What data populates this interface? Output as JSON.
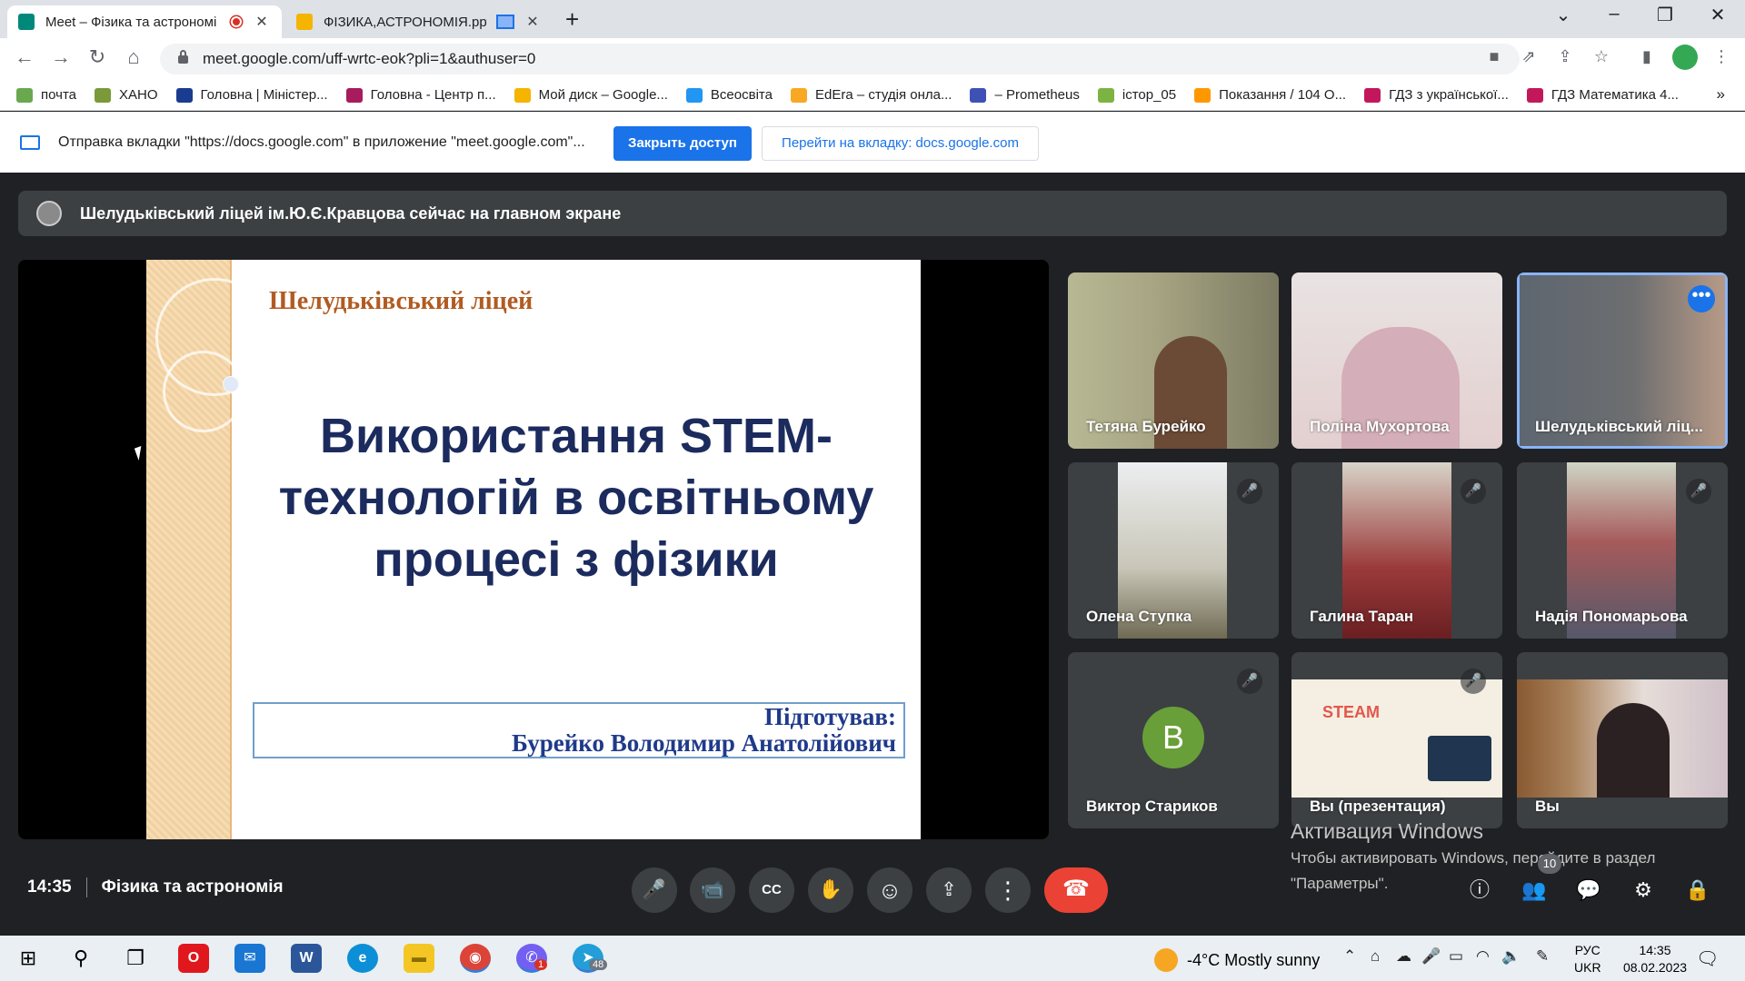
{
  "browser": {
    "tabs": [
      {
        "title": "Meet – Фізика та астрономі",
        "close": "✕",
        "favicon_color": "#00897b"
      },
      {
        "title": "ФІЗИКА,АСТРОНОМІЯ.pptx",
        "close": "✕",
        "favicon_color": "#f4b400"
      }
    ],
    "new_tab": "+",
    "url": "meet.google.com/uff-wrtc-eok?pli=1&authuser=0",
    "window_controls": {
      "tab_search": "⌄",
      "minimize": "–",
      "maximize": "❐",
      "close": "✕"
    },
    "nav": {
      "back": "←",
      "forward": "→",
      "reload": "↻",
      "home": "⌂"
    },
    "omnibox_icons": {
      "camera": "■",
      "open": "⇗",
      "share": "⇪",
      "star": "☆",
      "sidebar": "▮",
      "menu": "⋮"
    },
    "bookmarks": [
      {
        "label": "почта",
        "icon_color": "#6aa84f"
      },
      {
        "label": "ХАНО",
        "icon_color": "#7a9a3a"
      },
      {
        "label": "Головна | Міністер...",
        "icon_color": "#1a3c8f"
      },
      {
        "label": "Головна - Центр п...",
        "icon_color": "#a61c5c"
      },
      {
        "label": "Мой диск – Google...",
        "icon_color": "#f4b400"
      },
      {
        "label": "Всеосвіта",
        "icon_color": "#2196f3"
      },
      {
        "label": "EdEra – студія онла...",
        "icon_color": "#f9a825"
      },
      {
        "label": "– Prometheus",
        "icon_color": "#3f51b5"
      },
      {
        "label": "істор_05",
        "icon_color": "#7cb342"
      },
      {
        "label": "Показання / 104 О...",
        "icon_color": "#ff9800"
      },
      {
        "label": "ГДЗ з української...",
        "icon_color": "#c2185b"
      },
      {
        "label": "ГДЗ Математика 4...",
        "icon_color": "#c2185b"
      }
    ],
    "bookmarks_more": "»"
  },
  "infobar": {
    "message": "Отправка вкладки \"https://docs.google.com\" в приложение \"meet.google.com\"...",
    "stop_label": "Закрыть доступ",
    "goto_label": "Перейти на вкладку: docs.google.com"
  },
  "meet": {
    "banner": "Шелудьківський ліцей ім.Ю.Є.Кравцова сейчас на главном экране",
    "slide": {
      "school": "Шелудьківський ліцей",
      "title_lines": [
        "Використання STEM-",
        "технологій в освітньому",
        "процесі з фізики"
      ],
      "author_label": "Підготував:",
      "author_name": "Бурейко Володимир Анатолійович"
    },
    "participants": [
      {
        "name": "Тетяна Бурейко",
        "muted": false
      },
      {
        "name": "Поліна Мухортова",
        "muted": false
      },
      {
        "name": "Шелудьківський ліц...",
        "muted": false,
        "more": "•••"
      },
      {
        "name": "Олена Ступка",
        "muted": true
      },
      {
        "name": "Галина Таран",
        "muted": true
      },
      {
        "name": "Надія Пономарьова",
        "muted": true
      },
      {
        "name": "Виктор Стариков",
        "muted": true,
        "avatar_letter": "B"
      },
      {
        "name": "Вы (презентация)",
        "muted": true
      },
      {
        "name": "Вы",
        "muted": false
      }
    ],
    "presentation_thumb": "STEAM",
    "mic_off_icon": "🎤",
    "time": "14:35",
    "meeting_title": "Фізика та астрономія",
    "controls": {
      "mic": "🎤",
      "camera": "📹",
      "captions": "CC",
      "hand": "✋",
      "emoji": "☺",
      "present": "⇪",
      "more": "⋮",
      "hangup": "☎"
    },
    "right_controls": {
      "info": "ⓘ",
      "people": "👥",
      "chat": "💬",
      "activities": "⚙",
      "host": "🔒"
    },
    "people_count": "10"
  },
  "windows_activation": {
    "title": "Активация Windows",
    "line1": "Чтобы активировать Windows, перейдите в раздел",
    "line2": "\"Параметры\"."
  },
  "taskbar": {
    "start": "⊞",
    "search": "⚲",
    "task_view": "❐",
    "apps": [
      {
        "name": "opera",
        "glyph": "O",
        "color": "#e0181e"
      },
      {
        "name": "mail",
        "glyph": "✉",
        "color": "#1976d2"
      },
      {
        "name": "word",
        "glyph": "W",
        "color": "#2b579a"
      },
      {
        "name": "edge",
        "glyph": "e",
        "color": "#0c8fd6"
      },
      {
        "name": "explorer",
        "glyph": "▬",
        "color": "#f3c623"
      },
      {
        "name": "chrome",
        "glyph": "◉",
        "color": "#db4437"
      },
      {
        "name": "viber",
        "glyph": "✆",
        "color": "#7360f2",
        "badge": "1"
      },
      {
        "name": "telegram",
        "glyph": "➤",
        "color": "#229ed9",
        "badge": "48"
      }
    ],
    "weather": "-4°C  Mostly sunny",
    "tray": {
      "up": "⌃",
      "net": "⌂",
      "cloud": "☁",
      "mic": "🎤",
      "battery": "▭",
      "wifi": "◠",
      "volume": "🔈",
      "pen": "✎"
    },
    "lang_top": "РУС",
    "lang_bottom": "UKR",
    "time": "14:35",
    "date": "08.02.2023",
    "notifications": "🗨"
  }
}
